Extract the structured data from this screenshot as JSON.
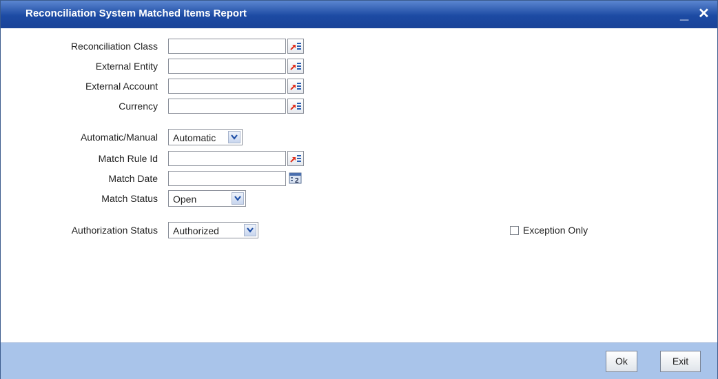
{
  "window": {
    "title": "Reconciliation System Matched Items Report",
    "minimize_label": "_",
    "close_label": "✕"
  },
  "form": {
    "reconciliation_class": {
      "label": "Reconciliation Class",
      "value": ""
    },
    "external_entity": {
      "label": "External Entity",
      "value": ""
    },
    "external_account": {
      "label": "External Account",
      "value": ""
    },
    "currency": {
      "label": "Currency",
      "value": ""
    },
    "automatic_manual": {
      "label": "Automatic/Manual",
      "value": "Automatic"
    },
    "match_rule_id": {
      "label": "Match Rule Id",
      "value": ""
    },
    "match_date": {
      "label": "Match Date",
      "value": ""
    },
    "match_status": {
      "label": "Match Status",
      "value": "Open"
    },
    "authorization_status": {
      "label": "Authorization Status",
      "value": "Authorized"
    },
    "exception_only": {
      "label": "Exception Only",
      "checked": false
    }
  },
  "footer": {
    "ok_label": "Ok",
    "exit_label": "Exit"
  },
  "icons": {
    "lov": "list-of-values-icon",
    "calendar": "calendar-icon",
    "dropdown": "chevron-down-icon"
  },
  "colors": {
    "titlebar": "#1c4aa3",
    "footer": "#a9c4ea"
  }
}
